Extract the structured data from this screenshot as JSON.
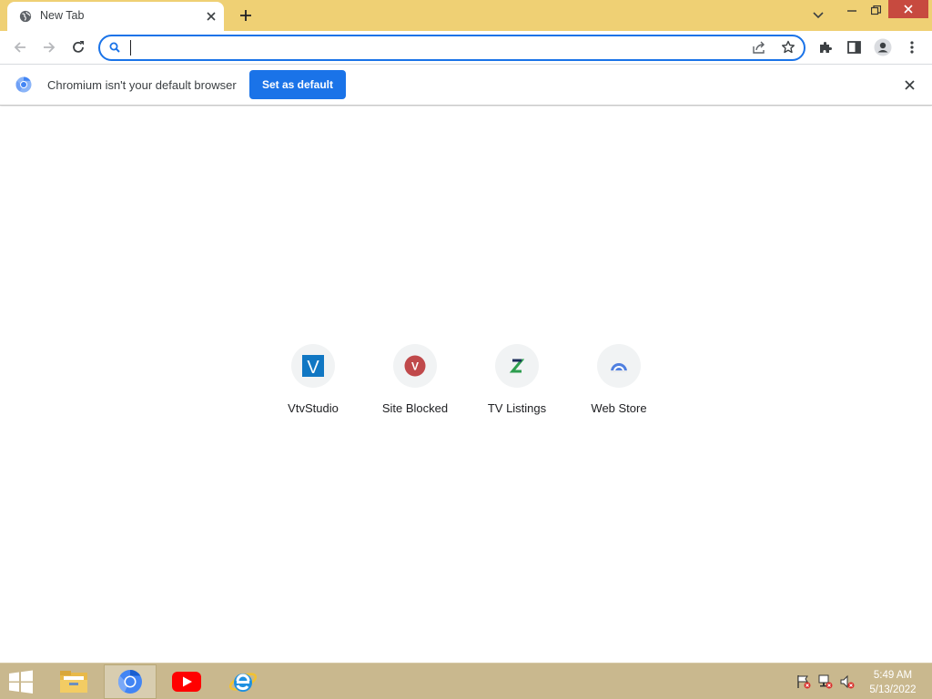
{
  "browser": {
    "tab": {
      "title": "New Tab",
      "favicon": "globe-icon"
    },
    "window_controls": [
      "tab-search-icon",
      "minimize-icon",
      "restore-icon",
      "close-icon"
    ]
  },
  "toolbar": {
    "omnibox": {
      "value": "",
      "placeholder": ""
    }
  },
  "infobar": {
    "message": "Chromium isn't your default browser",
    "button_label": "Set as default"
  },
  "shortcuts": [
    {
      "label": "VtvStudio",
      "icon_letter": "V",
      "color": "#1177c3"
    },
    {
      "label": "Site Blocked",
      "icon_letter": "V",
      "color": "#c0494b"
    },
    {
      "label": "TV Listings",
      "icon_letter": "Z",
      "color": "#2e9e4f"
    },
    {
      "label": "Web Store",
      "icon_letter": "",
      "color": "#4f7fe0"
    }
  ],
  "taskbar": {
    "apps": [
      "file-explorer",
      "chromium",
      "youtube",
      "internet-explorer"
    ],
    "clock": {
      "time": "5:49 AM",
      "date": "5/13/2022"
    }
  },
  "colors": {
    "titlebar": "#efd074",
    "accent": "#1a73e8",
    "taskbar": "#c9b88e",
    "close": "#c74a3f"
  }
}
